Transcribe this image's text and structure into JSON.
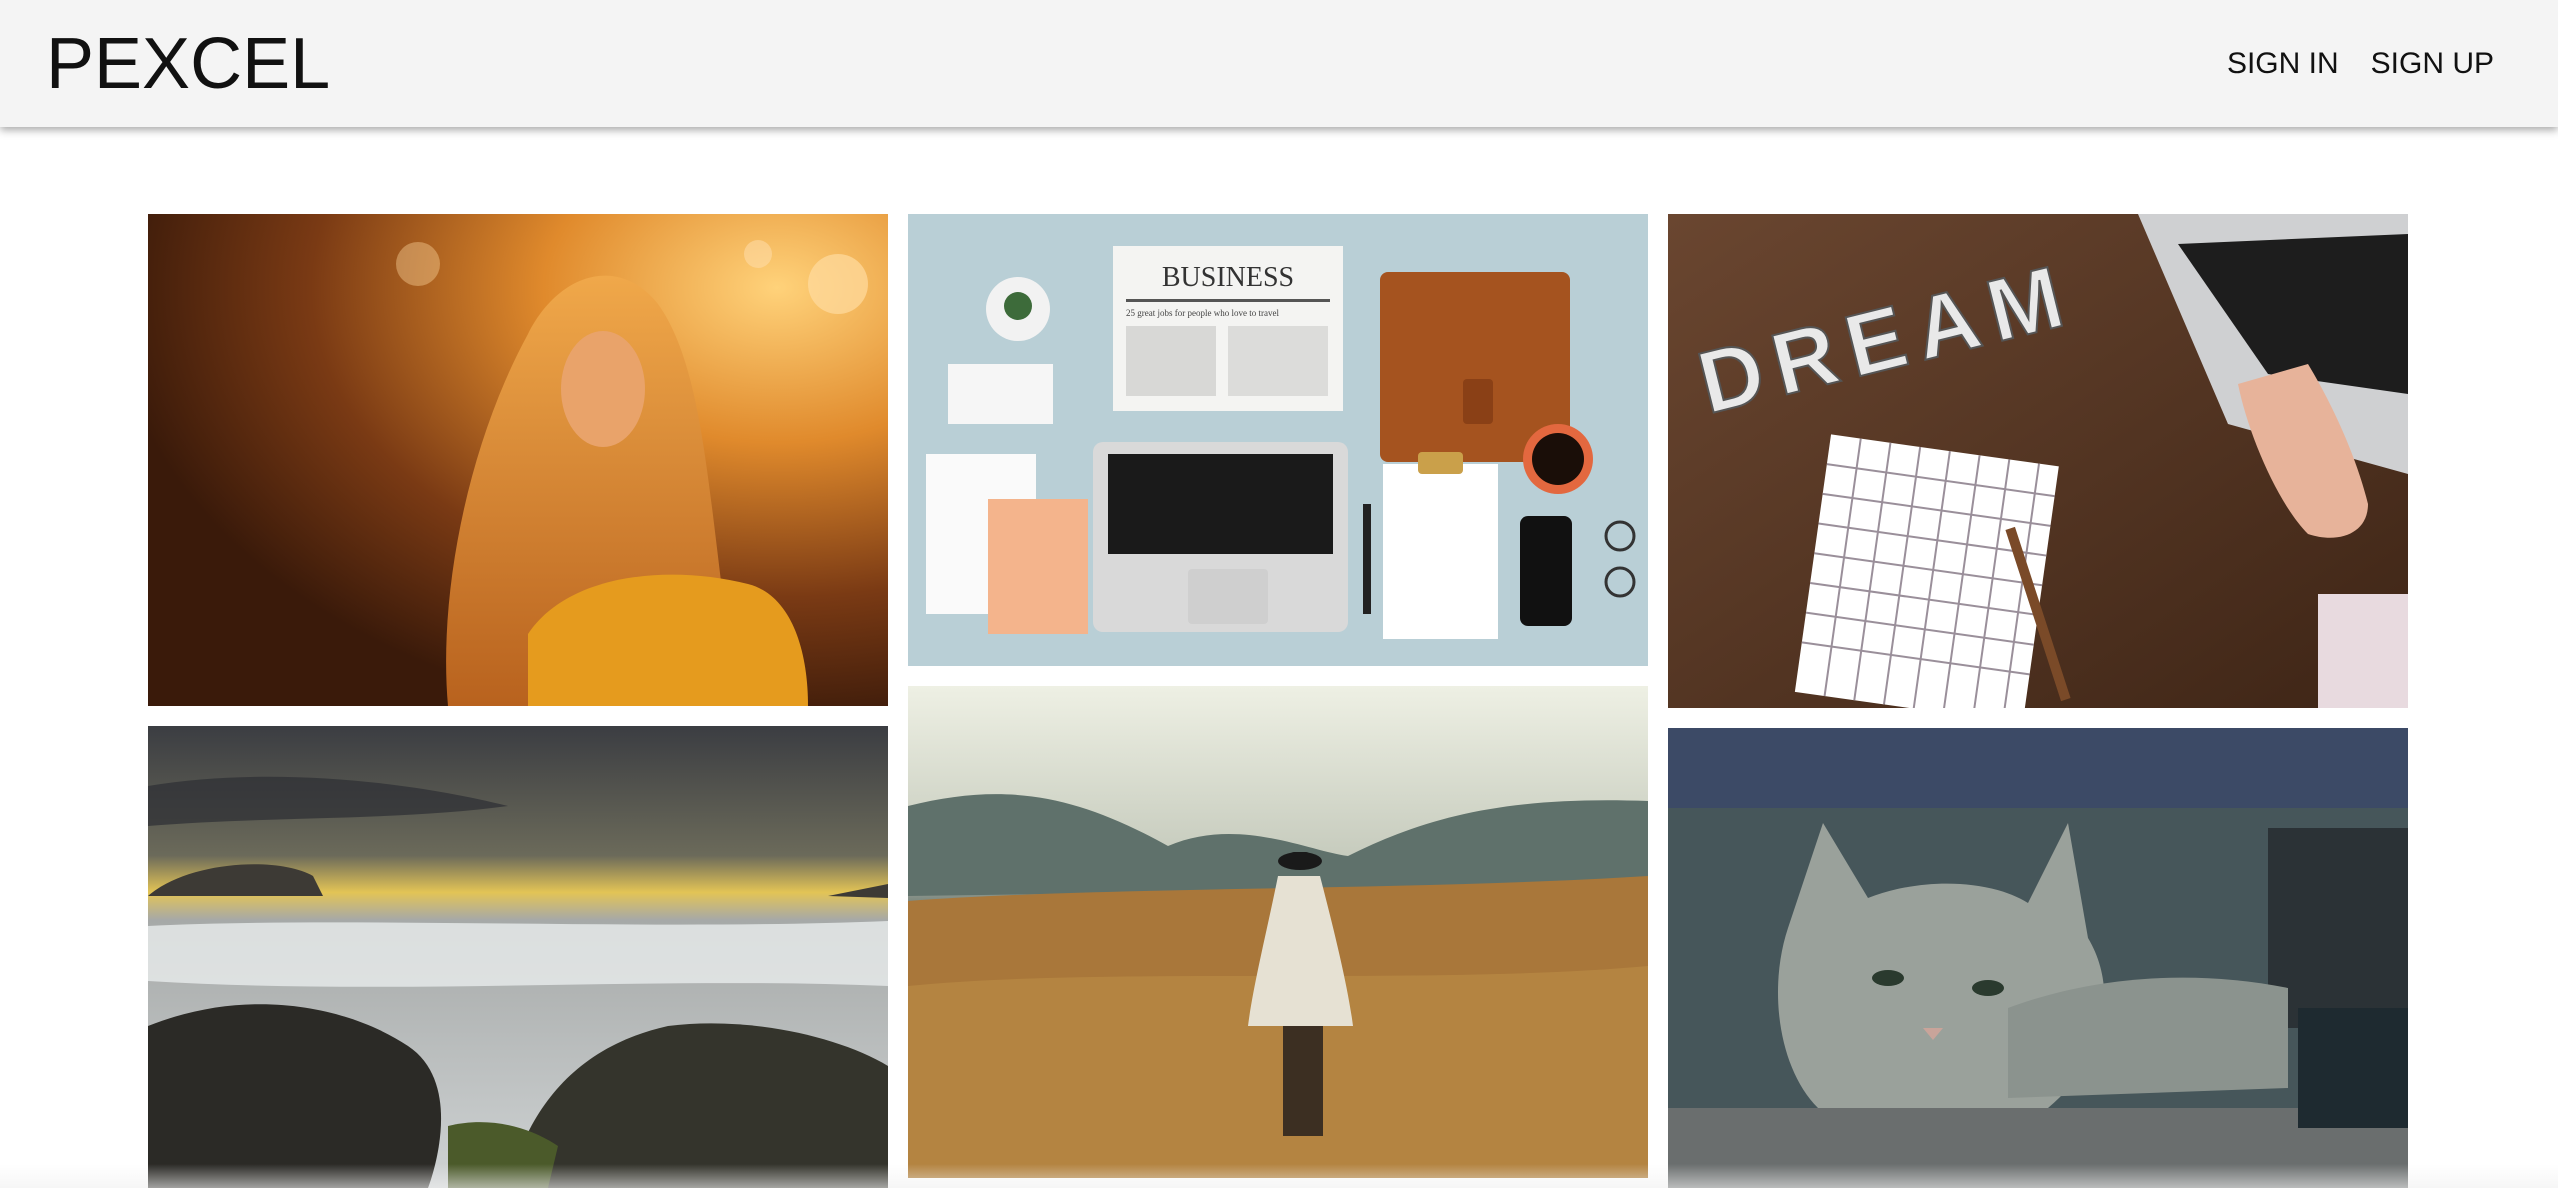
{
  "header": {
    "logo": "PEXCEL",
    "nav": [
      {
        "label": "SIGN IN"
      },
      {
        "label": "SIGN UP"
      }
    ]
  },
  "gallery": {
    "photos": [
      {
        "subject": "woman-sunset-portrait"
      },
      {
        "subject": "business-desk-flatlay",
        "text": "BUSINESS",
        "subtext": "25 great jobs for people who love to travel"
      },
      {
        "subject": "dream-letters-laptop",
        "text": "DREAM"
      },
      {
        "subject": "seascape-rocks"
      },
      {
        "subject": "woman-wheat-field"
      },
      {
        "subject": "tabby-cat"
      }
    ]
  }
}
